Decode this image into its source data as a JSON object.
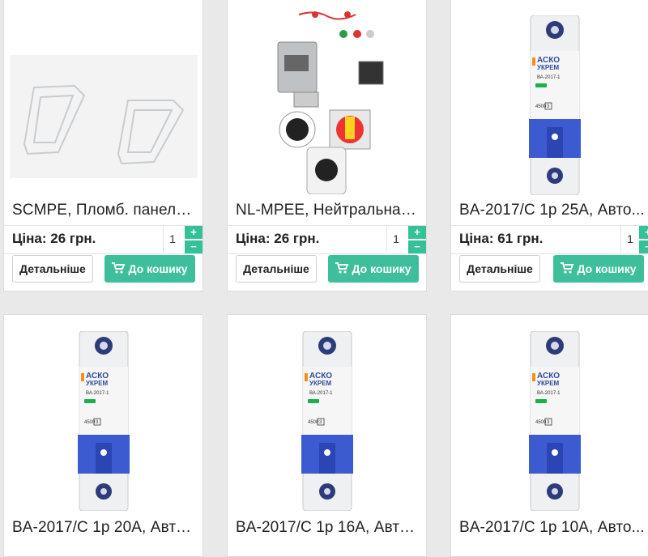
{
  "colors": {
    "accent": "#3dbf9c",
    "background": "#e9e9e9",
    "card": "#ffffff"
  },
  "labels": {
    "details": "Детальніше",
    "to_cart": "До кошику",
    "plus": "+",
    "minus": "−"
  },
  "products": [
    {
      "title": "SCMPE, Пломб. панель ...",
      "price": "Ціна: 26 грн.",
      "qty": "1",
      "image": "seal-panels-image"
    },
    {
      "title": "NL-MPEE, Нейтральна к...",
      "price": "Ціна: 26 грн.",
      "qty": "1",
      "image": "switchgear-kit-image"
    },
    {
      "title": "BA-2017/C 1p 25A, Авто...",
      "price": "Ціна: 61 грн.",
      "qty": "1",
      "image": "circuit-breaker-image"
    },
    {
      "title": "BA-2017/C 1p 20A, Авто...",
      "image": "circuit-breaker-image"
    },
    {
      "title": "BA-2017/C 1p 16A, Авто...",
      "image": "circuit-breaker-image"
    },
    {
      "title": "BA-2017/C 1p 10A, Авто...",
      "image": "circuit-breaker-image"
    }
  ],
  "breaker_label": {
    "brand_top": "АСКО",
    "brand_bottom": "УКРЕМ",
    "model": "ВА-2017-1",
    "code": "4500",
    "class": "3"
  }
}
